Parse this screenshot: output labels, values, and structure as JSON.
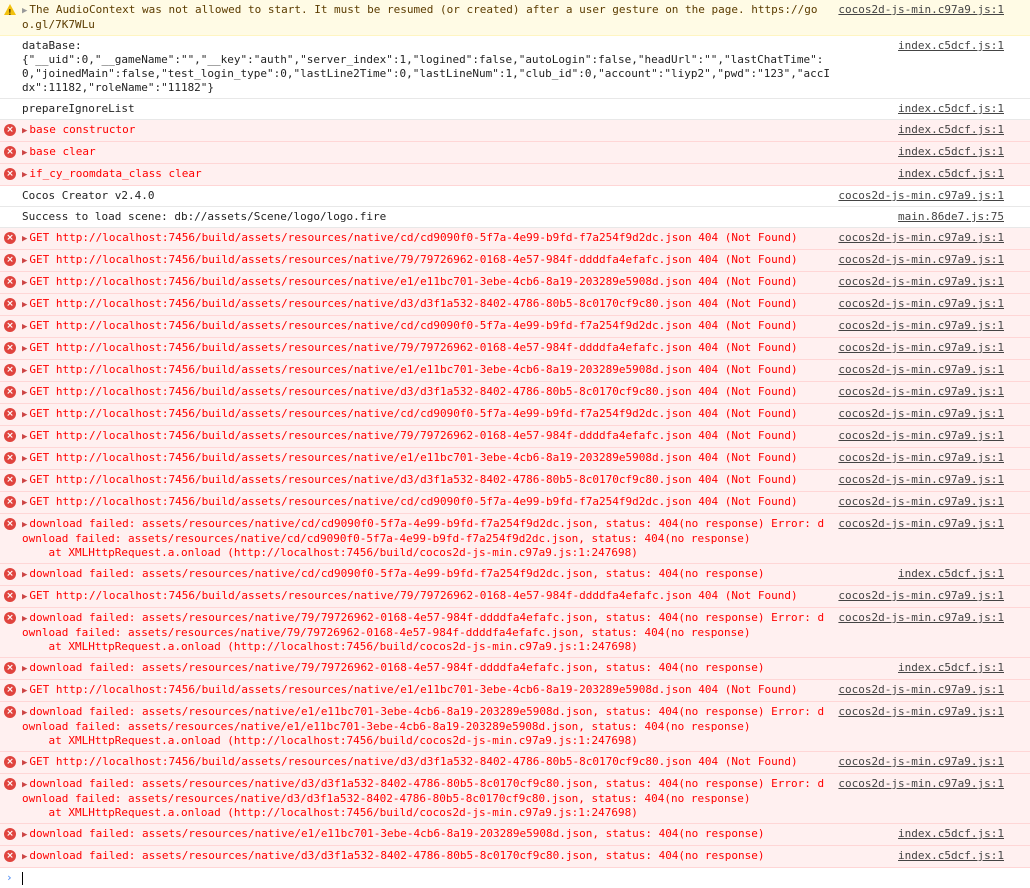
{
  "rows": [
    {
      "level": "warn",
      "expandable": true,
      "text": "The AudioContext was not allowed to start. It must be resumed (or created) after a user gesture on the page. https://goo.gl/7K7WLu",
      "src": "cocos2d-js-min.c97a9.js:1"
    },
    {
      "level": "log",
      "expandable": false,
      "text": "dataBase:\n{\"__uid\":0,\"__gameName\":\"\",\"__key\":\"auth\",\"server_index\":1,\"logined\":false,\"autoLogin\":false,\"headUrl\":\"\",\"lastChatTime\":0,\"joinedMain\":false,\"test_login_type\":0,\"lastLine2Time\":0,\"lastLineNum\":1,\"club_id\":0,\"account\":\"liyp2\",\"pwd\":\"123\",\"accIdx\":11182,\"roleName\":\"11182\"}",
      "src": "index.c5dcf.js:1"
    },
    {
      "level": "log",
      "expandable": false,
      "text": "prepareIgnoreList",
      "src": "index.c5dcf.js:1"
    },
    {
      "level": "error",
      "expandable": true,
      "text": "base constructor",
      "src": "index.c5dcf.js:1"
    },
    {
      "level": "error",
      "expandable": true,
      "text": "base clear",
      "src": "index.c5dcf.js:1"
    },
    {
      "level": "error",
      "expandable": true,
      "text": "if_cy_roomdata_class clear",
      "src": "index.c5dcf.js:1"
    },
    {
      "level": "log",
      "expandable": false,
      "text": "Cocos Creator v2.4.0",
      "src": "cocos2d-js-min.c97a9.js:1"
    },
    {
      "level": "log",
      "expandable": false,
      "text": "Success to load scene: db://assets/Scene/logo/logo.fire",
      "src": "main.86de7.js:75"
    },
    {
      "level": "error",
      "expandable": true,
      "text": "GET http://localhost:7456/build/assets/resources/native/cd/cd9090f0-5f7a-4e99-b9fd-f7a254f9d2dc.json 404 (Not Found)",
      "src": "cocos2d-js-min.c97a9.js:1"
    },
    {
      "level": "error",
      "expandable": true,
      "text": "GET http://localhost:7456/build/assets/resources/native/79/79726962-0168-4e57-984f-ddddfa4efafc.json 404 (Not Found)",
      "src": "cocos2d-js-min.c97a9.js:1"
    },
    {
      "level": "error",
      "expandable": true,
      "text": "GET http://localhost:7456/build/assets/resources/native/e1/e11bc701-3ebe-4cb6-8a19-203289e5908d.json 404 (Not Found)",
      "src": "cocos2d-js-min.c97a9.js:1"
    },
    {
      "level": "error",
      "expandable": true,
      "text": "GET http://localhost:7456/build/assets/resources/native/d3/d3f1a532-8402-4786-80b5-8c0170cf9c80.json 404 (Not Found)",
      "src": "cocos2d-js-min.c97a9.js:1"
    },
    {
      "level": "error",
      "expandable": true,
      "text": "GET http://localhost:7456/build/assets/resources/native/cd/cd9090f0-5f7a-4e99-b9fd-f7a254f9d2dc.json 404 (Not Found)",
      "src": "cocos2d-js-min.c97a9.js:1"
    },
    {
      "level": "error",
      "expandable": true,
      "text": "GET http://localhost:7456/build/assets/resources/native/79/79726962-0168-4e57-984f-ddddfa4efafc.json 404 (Not Found)",
      "src": "cocos2d-js-min.c97a9.js:1"
    },
    {
      "level": "error",
      "expandable": true,
      "text": "GET http://localhost:7456/build/assets/resources/native/e1/e11bc701-3ebe-4cb6-8a19-203289e5908d.json 404 (Not Found)",
      "src": "cocos2d-js-min.c97a9.js:1"
    },
    {
      "level": "error",
      "expandable": true,
      "text": "GET http://localhost:7456/build/assets/resources/native/d3/d3f1a532-8402-4786-80b5-8c0170cf9c80.json 404 (Not Found)",
      "src": "cocos2d-js-min.c97a9.js:1"
    },
    {
      "level": "error",
      "expandable": true,
      "text": "GET http://localhost:7456/build/assets/resources/native/cd/cd9090f0-5f7a-4e99-b9fd-f7a254f9d2dc.json 404 (Not Found)",
      "src": "cocos2d-js-min.c97a9.js:1"
    },
    {
      "level": "error",
      "expandable": true,
      "text": "GET http://localhost:7456/build/assets/resources/native/79/79726962-0168-4e57-984f-ddddfa4efafc.json 404 (Not Found)",
      "src": "cocos2d-js-min.c97a9.js:1"
    },
    {
      "level": "error",
      "expandable": true,
      "text": "GET http://localhost:7456/build/assets/resources/native/e1/e11bc701-3ebe-4cb6-8a19-203289e5908d.json 404 (Not Found)",
      "src": "cocos2d-js-min.c97a9.js:1"
    },
    {
      "level": "error",
      "expandable": true,
      "text": "GET http://localhost:7456/build/assets/resources/native/d3/d3f1a532-8402-4786-80b5-8c0170cf9c80.json 404 (Not Found)",
      "src": "cocos2d-js-min.c97a9.js:1"
    },
    {
      "level": "error",
      "expandable": true,
      "text": "GET http://localhost:7456/build/assets/resources/native/cd/cd9090f0-5f7a-4e99-b9fd-f7a254f9d2dc.json 404 (Not Found)",
      "src": "cocos2d-js-min.c97a9.js:1"
    },
    {
      "level": "error",
      "expandable": true,
      "text": "download failed: assets/resources/native/cd/cd9090f0-5f7a-4e99-b9fd-f7a254f9d2dc.json, status: 404(no response) Error: download failed: assets/resources/native/cd/cd9090f0-5f7a-4e99-b9fd-f7a254f9d2dc.json, status: 404(no response)\n    at XMLHttpRequest.a.onload (http://localhost:7456/build/cocos2d-js-min.c97a9.js:1:247698)",
      "src": "cocos2d-js-min.c97a9.js:1"
    },
    {
      "level": "error",
      "expandable": true,
      "text": "download failed: assets/resources/native/cd/cd9090f0-5f7a-4e99-b9fd-f7a254f9d2dc.json, status: 404(no response)",
      "src": "index.c5dcf.js:1"
    },
    {
      "level": "error",
      "expandable": true,
      "text": "GET http://localhost:7456/build/assets/resources/native/79/79726962-0168-4e57-984f-ddddfa4efafc.json 404 (Not Found)",
      "src": "cocos2d-js-min.c97a9.js:1"
    },
    {
      "level": "error",
      "expandable": true,
      "text": "download failed: assets/resources/native/79/79726962-0168-4e57-984f-ddddfa4efafc.json, status: 404(no response) Error: download failed: assets/resources/native/79/79726962-0168-4e57-984f-ddddfa4efafc.json, status: 404(no response)\n    at XMLHttpRequest.a.onload (http://localhost:7456/build/cocos2d-js-min.c97a9.js:1:247698)",
      "src": "cocos2d-js-min.c97a9.js:1"
    },
    {
      "level": "error",
      "expandable": true,
      "text": "download failed: assets/resources/native/79/79726962-0168-4e57-984f-ddddfa4efafc.json, status: 404(no response)",
      "src": "index.c5dcf.js:1"
    },
    {
      "level": "error",
      "expandable": true,
      "text": "GET http://localhost:7456/build/assets/resources/native/e1/e11bc701-3ebe-4cb6-8a19-203289e5908d.json 404 (Not Found)",
      "src": "cocos2d-js-min.c97a9.js:1"
    },
    {
      "level": "error",
      "expandable": true,
      "text": "download failed: assets/resources/native/e1/e11bc701-3ebe-4cb6-8a19-203289e5908d.json, status: 404(no response) Error: download failed: assets/resources/native/e1/e11bc701-3ebe-4cb6-8a19-203289e5908d.json, status: 404(no response)\n    at XMLHttpRequest.a.onload (http://localhost:7456/build/cocos2d-js-min.c97a9.js:1:247698)",
      "src": "cocos2d-js-min.c97a9.js:1"
    },
    {
      "level": "error",
      "expandable": true,
      "text": "GET http://localhost:7456/build/assets/resources/native/d3/d3f1a532-8402-4786-80b5-8c0170cf9c80.json 404 (Not Found)",
      "src": "cocos2d-js-min.c97a9.js:1"
    },
    {
      "level": "error",
      "expandable": true,
      "text": "download failed: assets/resources/native/d3/d3f1a532-8402-4786-80b5-8c0170cf9c80.json, status: 404(no response) Error: download failed: assets/resources/native/d3/d3f1a532-8402-4786-80b5-8c0170cf9c80.json, status: 404(no response)\n    at XMLHttpRequest.a.onload (http://localhost:7456/build/cocos2d-js-min.c97a9.js:1:247698)",
      "src": "cocos2d-js-min.c97a9.js:1"
    },
    {
      "level": "error",
      "expandable": true,
      "text": "download failed: assets/resources/native/e1/e11bc701-3ebe-4cb6-8a19-203289e5908d.json, status: 404(no response)",
      "src": "index.c5dcf.js:1"
    },
    {
      "level": "error",
      "expandable": true,
      "text": "download failed: assets/resources/native/d3/d3f1a532-8402-4786-80b5-8c0170cf9c80.json, status: 404(no response)",
      "src": "index.c5dcf.js:1"
    }
  ],
  "prompt": {
    "chevron": "›"
  },
  "icons": {
    "error": "error-icon",
    "warn": "warning-icon",
    "expand": "expand-triangle-icon",
    "prompt": "prompt-chevron-icon"
  },
  "colors": {
    "error_bg": "#fff0f0",
    "error_text": "#ff0000",
    "warn_bg": "#fffbe5",
    "error_icon": "#e0443e",
    "warn_icon": "#f2c10e"
  }
}
